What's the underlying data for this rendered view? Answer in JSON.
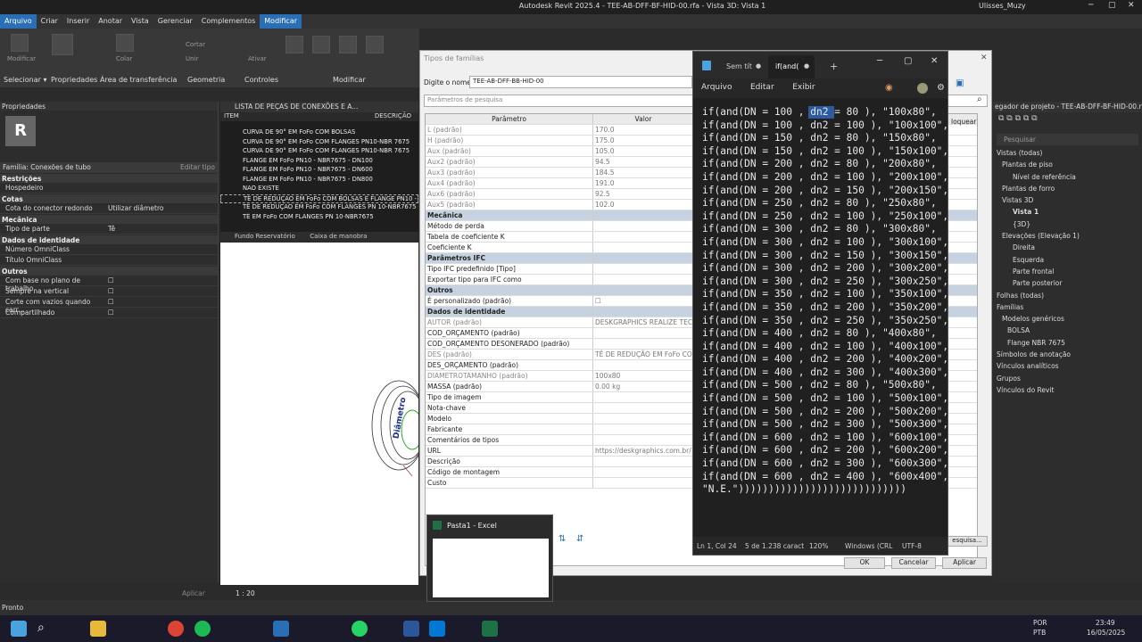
{
  "app": {
    "title": "Autodesk Revit 2025.4 - TEE-AB-DFF-BF-HID-00.rfa - Vista 3D: Vista 1",
    "user": "Ulisses_Muzy"
  },
  "menu": [
    "Arquivo",
    "Criar",
    "Inserir",
    "Anotar",
    "Vista",
    "Gerenciar",
    "Complementos",
    "Modificar"
  ],
  "ribbon": {
    "groups": [
      "Selecionar ▾",
      "Propriedades",
      "Área de transferência",
      "Geometria",
      "Controles",
      "Modificar"
    ],
    "small": [
      "Modificar",
      "Colar",
      "Cortar",
      "Unir",
      "Ativar"
    ]
  },
  "properties": {
    "title": "Propriedades",
    "family": "Família: Conexões de tubo",
    "edit_type": "Editar tipo",
    "apply": "Aplicar",
    "sections": [
      {
        "name": "Restrições",
        "rows": [
          {
            "k": "Hospedeiro",
            "v": ""
          }
        ]
      },
      {
        "name": "Cotas",
        "rows": [
          {
            "k": "Cota do conector redondo",
            "v": "Utilizar diâmetro"
          }
        ]
      },
      {
        "name": "Mecânica",
        "rows": [
          {
            "k": "Tipo de parte",
            "v": "Tê"
          }
        ]
      },
      {
        "name": "Dados de identidade",
        "rows": [
          {
            "k": "Número OmniClass",
            "v": ""
          },
          {
            "k": "Título OmniClass",
            "v": ""
          }
        ]
      },
      {
        "name": "Outros",
        "rows": [
          {
            "k": "Com base no plano de trabalho",
            "v": "☐"
          },
          {
            "k": "Sempre na vertical",
            "v": "☐"
          },
          {
            "k": "Corte com vazios quando carr...",
            "v": "☐"
          },
          {
            "k": "Compartilhado",
            "v": "☐"
          }
        ]
      }
    ]
  },
  "list": {
    "title": "LISTA DE PEÇAS DE CONEXÕES E A...",
    "col_item": "ITEM",
    "col_desc": "DESCRIÇÃO",
    "items": [
      "CURVA DE 90° EM FoFo COM BOLSAS",
      "CURVA DE 90° EM FoFo COM FLANGES PN10-NBR 7675",
      "CURVA DE 90° EM FoFo COM FLANGES PN10-NBR 7675",
      "FLANGE EM FoFo PN10 - NBR7675 - DN100",
      "FLANGE EM FoFo PN10 - NBR7675 - DN600",
      "FLANGE EM FoFo PN10 - NBR7675 - DN800",
      "NÃO EXISTE",
      "TÊ DE REDUÇÃO EM FoFo COM BOLSAS E FLANGE PN10 - ...",
      "TÊ DE REDUÇÃO EM FoFo COM FLANGES PN 10-NBR7675 - ...",
      "TÊ EM FoFo COM FLANGES PN 10-NBR7675"
    ]
  },
  "viewtabs": [
    "Fundo Reservatório",
    "Caixa de manobra"
  ],
  "view_label": "Diâmetro",
  "dialog": {
    "title": "Tipos de famílias",
    "name_label": "Digite o nome:",
    "name_value": "TEE-AB-DFF-BB-HID-00",
    "search_ph": "Parâmetros de pesquisa",
    "col_param": "Parâmetro",
    "col_value": "Valor",
    "lock": "loquear",
    "ok": "OK",
    "cancel": "Cancelar",
    "apply": "Aplicar",
    "search_btn": "esquisa...",
    "rows": [
      {
        "t": "grey",
        "p": "L (padrão)",
        "v": "170.0"
      },
      {
        "t": "grey",
        "p": "H (padrão)",
        "v": "175.0"
      },
      {
        "t": "grey",
        "p": "Aux (padrão)",
        "v": "105.0"
      },
      {
        "t": "grey",
        "p": "Aux2 (padrão)",
        "v": "94.5"
      },
      {
        "t": "grey",
        "p": "Aux3 (padrão)",
        "v": "184.5"
      },
      {
        "t": "grey",
        "p": "Aux4 (padrão)",
        "v": "191.0"
      },
      {
        "t": "grey",
        "p": "Aux6 (padrão)",
        "v": "92.5"
      },
      {
        "t": "grey",
        "p": "Aux5 (padrão)",
        "v": "102.0"
      },
      {
        "t": "sec",
        "p": "Mecânica",
        "v": ""
      },
      {
        "t": "",
        "p": "Método de perda",
        "v": ""
      },
      {
        "t": "",
        "p": "Tabela de coeficiente K",
        "v": ""
      },
      {
        "t": "",
        "p": "Coeficiente K",
        "v": ""
      },
      {
        "t": "sec",
        "p": "Parâmetros IFC",
        "v": ""
      },
      {
        "t": "",
        "p": "Tipo IFC predefinido [Tipo]",
        "v": ""
      },
      {
        "t": "",
        "p": "Exportar tipo para IFC como",
        "v": ""
      },
      {
        "t": "sec",
        "p": "Outros",
        "v": ""
      },
      {
        "t": "",
        "p": "É personalizado (padrão)",
        "v": "☐"
      },
      {
        "t": "sec",
        "p": "Dados de identidade",
        "v": ""
      },
      {
        "t": "grey",
        "p": "AUTOR (padrão)",
        "v": "DESKGRAPHICS REALIZE TECNO"
      },
      {
        "t": "",
        "p": "COD_ORÇAMENTO (padrão)",
        "v": ""
      },
      {
        "t": "",
        "p": "COD_ORÇAMENTO DESONERADO (padrão)",
        "v": ""
      },
      {
        "t": "grey",
        "p": "DES (padrão)",
        "v": "TÊ DE REDUÇÃO EM FoFo COM"
      },
      {
        "t": "",
        "p": "DES_ORÇAMENTO (padrão)",
        "v": ""
      },
      {
        "t": "grey",
        "p": "DIAMETROTAMANHO (padrão)",
        "v": "100x80"
      },
      {
        "t": "",
        "p": "MASSA (padrão)",
        "v": "0.00 kg"
      },
      {
        "t": "",
        "p": "Tipo de imagem",
        "v": ""
      },
      {
        "t": "",
        "p": "Nota-chave",
        "v": ""
      },
      {
        "t": "",
        "p": "Modelo",
        "v": ""
      },
      {
        "t": "",
        "p": "Fabricante",
        "v": ""
      },
      {
        "t": "",
        "p": "Comentários de tipos",
        "v": ""
      },
      {
        "t": "",
        "p": "URL",
        "v": "https://deskgraphics.com.br/"
      },
      {
        "t": "",
        "p": "Descrição",
        "v": ""
      },
      {
        "t": "",
        "p": "Código de montagem",
        "v": ""
      },
      {
        "t": "",
        "p": "Custo",
        "v": ""
      }
    ]
  },
  "notepad": {
    "tab1": "Sem tít",
    "tab2": "if(and(",
    "menu": [
      "Arquivo",
      "Editar",
      "Exibir"
    ],
    "lines": [
      "if(and(DN = 100 , dn2 = 80 ), \"100x80\",",
      "if(and(DN = 100 , dn2 = 100 ), \"100x100\",",
      "if(and(DN = 150 , dn2 = 80 ), \"150x80\",",
      "if(and(DN = 150 , dn2 = 100 ), \"150x100\",",
      "if(and(DN = 200 , dn2 = 80 ), \"200x80\",",
      "if(and(DN = 200 , dn2 = 100 ), \"200x100\",",
      "if(and(DN = 200 , dn2 = 150 ), \"200x150\",",
      "if(and(DN = 250 , dn2 = 80 ), \"250x80\",",
      "if(and(DN = 250 , dn2 = 100 ), \"250x100\",",
      "if(and(DN = 300 , dn2 = 80 ), \"300x80\",",
      "if(and(DN = 300 , dn2 = 100 ), \"300x100\",",
      "if(and(DN = 300 , dn2 = 150 ), \"300x150\",",
      "if(and(DN = 300 , dn2 = 200 ), \"300x200\",",
      "if(and(DN = 300 , dn2 = 250 ), \"300x250\",",
      "if(and(DN = 350 , dn2 = 100 ), \"350x100\",",
      "if(and(DN = 350 , dn2 = 200 ), \"350x200\",",
      "if(and(DN = 350 , dn2 = 250 ), \"350x250\",",
      "if(and(DN = 400 , dn2 = 80 ), \"400x80\",",
      "if(and(DN = 400 , dn2 = 100 ), \"400x100\",",
      "if(and(DN = 400 , dn2 = 200 ), \"400x200\",",
      "if(and(DN = 400 , dn2 = 300 ), \"400x300\",",
      "if(and(DN = 500 , dn2 = 80 ), \"500x80\",",
      "if(and(DN = 500 , dn2 = 100 ), \"500x100\",",
      "if(and(DN = 500 , dn2 = 200 ), \"500x200\",",
      "if(and(DN = 500 , dn2 = 300 ), \"500x300\",",
      "if(and(DN = 600 , dn2 = 100 ), \"600x100\",",
      "if(and(DN = 600 , dn2 = 200 ), \"600x200\",",
      "if(and(DN = 600 , dn2 = 300 ), \"600x300\",",
      "if(and(DN = 600 , dn2 = 400 ), \"600x400\",",
      "\"N.E.\"))))))))))))))))))))))))))))"
    ],
    "status": {
      "pos": "Ln 1, Col 24",
      "chars": "5 de 1.238 caract",
      "zoom": "120%",
      "eol": "Windows (CRL",
      "enc": "UTF-8"
    }
  },
  "browser": {
    "title": "egador de projeto - TEE-AB-DFF-BF-HID-00.rfa",
    "search_ph": "Pesquisar",
    "items": [
      "Vistas (todas)",
      "Plantas de piso",
      "Nível de referência",
      "Plantas de forro",
      "Vistas 3D",
      "Vista 1",
      "{3D}",
      "Elevações (Elevação 1)",
      "Direita",
      "Esquerda",
      "Parte frontal",
      "Parte posterior",
      "Folhas (todas)",
      "Famílias",
      "Modelos genéricos",
      "BOLSA",
      "Flange NBR 7675",
      "Símbolos de anotação",
      "Vínculos analíticos",
      "Grupos",
      "Vínculos do Revit"
    ]
  },
  "excel": {
    "title": "Pasta1 - Excel"
  },
  "status": {
    "ready": "Pronto",
    "scale": "1 : 20",
    "apply": "Aplicar"
  },
  "taskbar": {
    "lang": "POR",
    "layout": "PTB",
    "time": "23:49",
    "date": "16/05/2025"
  }
}
